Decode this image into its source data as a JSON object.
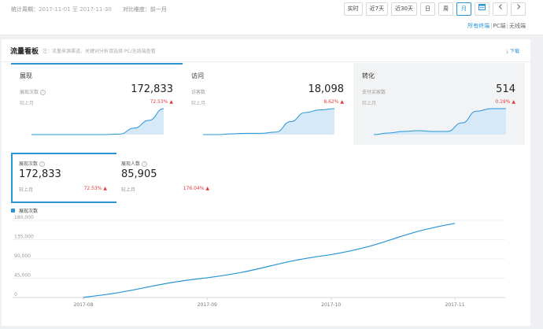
{
  "toolbar": {
    "period_label": "统计周期：",
    "period_start": "2017-11-01",
    "period_to": "至",
    "period_end": "2017-11-30",
    "compare_label": "对比维度：",
    "compare_value": "前一月",
    "buttons": [
      {
        "label": "实时"
      },
      {
        "label": "近7天"
      },
      {
        "label": "近30天"
      },
      {
        "label": "日"
      },
      {
        "label": "周"
      },
      {
        "label": "月"
      }
    ],
    "active_button": "月",
    "calendar_icon": "calendar-icon",
    "prev_icon": "chevron-left-icon",
    "next_icon": "chevron-right-icon",
    "terminals": [
      "所有终端",
      "PC端",
      "无线端"
    ],
    "terminal_selected": "所有终端",
    "separator": "|"
  },
  "panel": {
    "title": "流量看板",
    "note": "注：流量来源渠道、关键词分析请选择 PC/无线端查看",
    "download": "下载",
    "download_icon": "download-icon"
  },
  "cards": [
    {
      "name": "展现",
      "metric_label": "展现次数",
      "value": "172,833",
      "mom_label": "较上月",
      "mom_value": "72.53%",
      "trend_icon": "arrow-up-icon",
      "sparkline": [
        0,
        0,
        0,
        0,
        0,
        0,
        0.02,
        0.25,
        0.55,
        1.0
      ]
    },
    {
      "name": "访问",
      "metric_label": "访客数",
      "value": "18,098",
      "mom_label": "较上月",
      "mom_value": "8.62%",
      "trend_icon": "arrow-up-icon",
      "sparkline": [
        0,
        0,
        0.03,
        0.05,
        0.05,
        0.1,
        0.5,
        0.85,
        0.95,
        1.0
      ]
    },
    {
      "name": "转化",
      "metric_label": "支付买家数",
      "value": "514",
      "mom_label": "较上月",
      "mom_value": "0.19%",
      "trend_icon": "arrow-up-icon",
      "sparkline": [
        0,
        0.06,
        0.12,
        0.15,
        0.12,
        0.12,
        0.45,
        0.9,
        1.0,
        1.0
      ]
    }
  ],
  "detail": [
    {
      "label": "展现次数",
      "value": "172,833",
      "mom_label": "较上月",
      "mom_value": "72.53%",
      "trend_icon": "arrow-up-icon",
      "active": true
    },
    {
      "label": "展现人数",
      "value": "85,905",
      "mom_label": "较上月",
      "mom_value": "176.04%",
      "trend_icon": "arrow-up-icon",
      "active": false
    }
  ],
  "colors": {
    "accent": "#2a94d6",
    "up": "#e4393c",
    "area": "#d6e9f8"
  },
  "chart_data": {
    "type": "line",
    "legend": "展现次数",
    "legend_placement": "top-left",
    "x": [
      "2017-08",
      "2017-09",
      "2017-10",
      "2017-11"
    ],
    "series": [
      {
        "name": "展现次数",
        "values": [
          500,
          46000,
          100000,
          173000
        ]
      }
    ],
    "y_ticks": [
      "180,000",
      "135,000",
      "90,000",
      "45,000",
      "0"
    ],
    "ylim": [
      0,
      180000
    ],
    "grid": true
  }
}
